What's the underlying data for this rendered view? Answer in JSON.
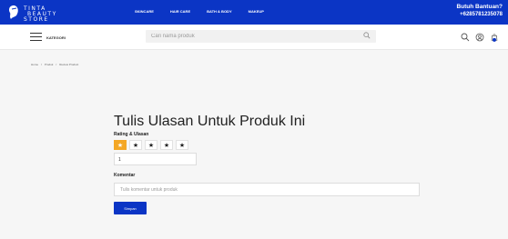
{
  "brand": {
    "line1": "TINTA",
    "line2": "BEAUTY",
    "line3": "STORE"
  },
  "nav": {
    "items": [
      "SKINCARE",
      "HAIR CARE",
      "BATH & BODY",
      "MAKEUP"
    ]
  },
  "help": {
    "title": "Butuh Bantuan?",
    "phone": "+6285781235078"
  },
  "subbar": {
    "kategori": "KATEGORI",
    "search_placeholder": "Cari nama produk"
  },
  "breadcrumb": {
    "home": "Home",
    "sep": "/",
    "produk": "Produk",
    "current": "Review Product"
  },
  "form": {
    "title": "Tulis Ulasan Untuk Produk Ini",
    "rating_label": "Rating & Ulasan",
    "stars": [
      "★",
      "★",
      "★",
      "★",
      "★"
    ],
    "active_stars": 1,
    "rating_value": "1",
    "komentar_label": "Komentar",
    "komentar_placeholder": "Tulis komentar untuk produk",
    "submit_label": "Simpan"
  },
  "colors": {
    "primary": "#0b35c5",
    "star_active": "#f4a724"
  }
}
